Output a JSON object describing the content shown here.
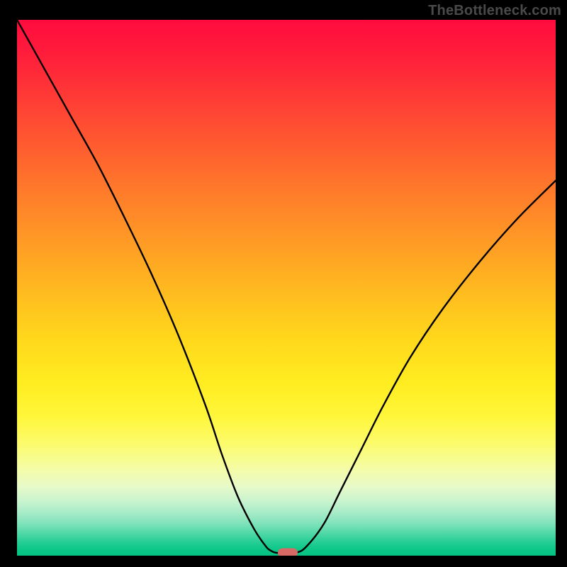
{
  "watermark": "TheBottleneck.com",
  "chart_data": {
    "type": "line",
    "title": "",
    "xlabel": "",
    "ylabel": "",
    "xlim": [
      0,
      100
    ],
    "ylim": [
      0,
      100
    ],
    "grid": false,
    "legend": false,
    "background_gradient": {
      "top": "#ff0b3e",
      "mid_upper": "#ff7e2a",
      "mid": "#ffed21",
      "mid_lower": "#c7f3cf",
      "bottom": "#05c383"
    },
    "series": [
      {
        "name": "bottleneck-curve",
        "color": "#000000",
        "x": [
          0,
          5,
          10,
          15,
          20,
          25,
          30,
          35,
          38,
          41,
          44,
          46,
          47,
          48.5,
          52,
          54,
          57,
          60,
          64,
          68,
          73,
          79,
          86,
          93,
          100
        ],
        "y": [
          100,
          91,
          82,
          73,
          63,
          52.5,
          41,
          28,
          19,
          11,
          5,
          2,
          1,
          0.5,
          0.6,
          2,
          6,
          12,
          20,
          28,
          37,
          46,
          55,
          63,
          70
        ]
      }
    ],
    "annotations": [
      {
        "name": "optimal-marker",
        "shape": "pill",
        "color": "#d86a66",
        "x": 50.2,
        "y": 0.5
      }
    ]
  }
}
